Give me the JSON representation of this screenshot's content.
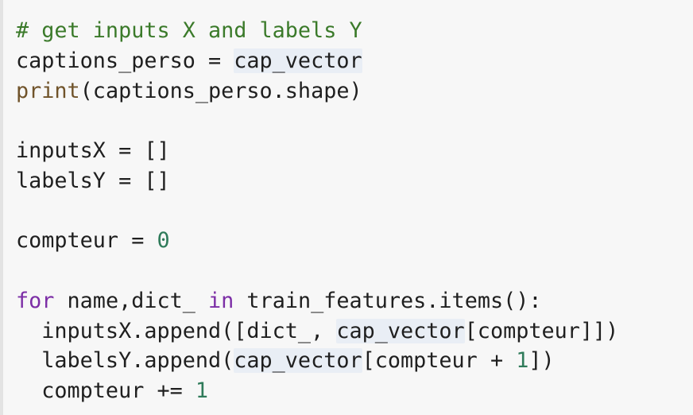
{
  "colors": {
    "background": "#f7f7f7",
    "text": "#1f1f1f",
    "comment": "#3b7a2a",
    "keyword": "#7c2ea6",
    "builtin": "#70532a",
    "number": "#2f7b5a",
    "highlight": "#e9eef5"
  },
  "code": {
    "lines": [
      [
        {
          "t": "# get inputs X and labels Y",
          "c": "comment"
        }
      ],
      [
        {
          "t": "captions_perso = "
        },
        {
          "t": "cap_vector",
          "c": "hl"
        }
      ],
      [
        {
          "t": "print",
          "c": "builtin"
        },
        {
          "t": "(captions_perso.shape)"
        }
      ],
      [],
      [
        {
          "t": "inputsX = []"
        }
      ],
      [
        {
          "t": "labelsY = []"
        }
      ],
      [],
      [
        {
          "t": "compteur = "
        },
        {
          "t": "0",
          "c": "number"
        }
      ],
      [],
      [
        {
          "t": "for",
          "c": "keyword"
        },
        {
          "t": " name,dict_ "
        },
        {
          "t": "in",
          "c": "keyword"
        },
        {
          "t": " train_features.items():"
        }
      ],
      [
        {
          "t": "  inputsX.append([dict_, "
        },
        {
          "t": "cap_vector",
          "c": "hl"
        },
        {
          "t": "[compteur]])"
        }
      ],
      [
        {
          "t": "  labelsY.append("
        },
        {
          "t": "cap_vector",
          "c": "hl"
        },
        {
          "t": "[compteur + "
        },
        {
          "t": "1",
          "c": "number"
        },
        {
          "t": "])"
        }
      ],
      [
        {
          "t": "  compteur += "
        },
        {
          "t": "1",
          "c": "number"
        }
      ]
    ]
  }
}
